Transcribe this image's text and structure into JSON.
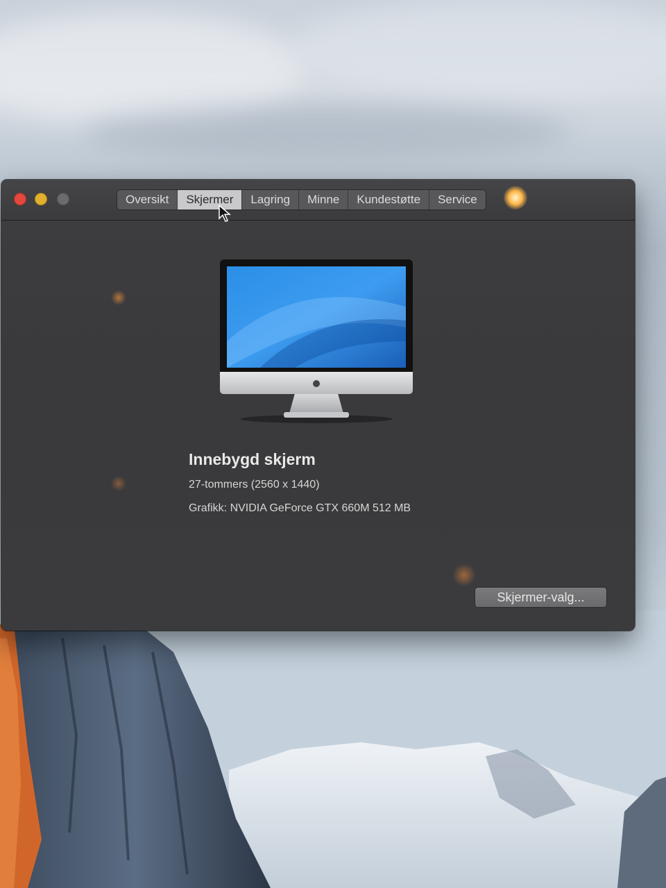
{
  "window": {
    "tabs": [
      "Oversikt",
      "Skjermer",
      "Lagring",
      "Minne",
      "Kundestøtte",
      "Service"
    ],
    "active_tab": "Skjermer"
  },
  "display": {
    "title": "Innebygd skjerm",
    "size_resolution": "27-tommers (2560 x 1440)",
    "graphics": "Grafikk: NVIDIA GeForce GTX 660M 512 MB",
    "options_button": "Skjermer-valg..."
  },
  "colors": {
    "close": "#e4473c",
    "minimize": "#e2b02c",
    "zoom_disabled": "#6b6b6d",
    "window_bg": "#3b3b3d"
  }
}
